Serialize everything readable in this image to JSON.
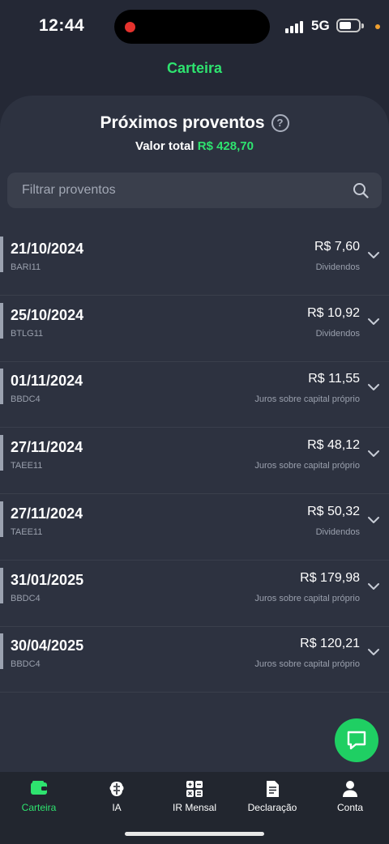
{
  "status_bar": {
    "time": "12:44",
    "network": "5G"
  },
  "header": {
    "title": "Carteira"
  },
  "panel": {
    "title": "Próximos proventos",
    "total_label": "Valor total",
    "total_value": "R$ 428,70"
  },
  "search": {
    "placeholder": "Filtrar proventos"
  },
  "items": [
    {
      "date": "21/10/2024",
      "ticker": "BARI11",
      "amount": "R$ 7,60",
      "type": "Dividendos"
    },
    {
      "date": "25/10/2024",
      "ticker": "BTLG11",
      "amount": "R$ 10,92",
      "type": "Dividendos"
    },
    {
      "date": "01/11/2024",
      "ticker": "BBDC4",
      "amount": "R$ 11,55",
      "type": "Juros sobre capital próprio"
    },
    {
      "date": "27/11/2024",
      "ticker": "TAEE11",
      "amount": "R$ 48,12",
      "type": "Juros sobre capital próprio"
    },
    {
      "date": "27/11/2024",
      "ticker": "TAEE11",
      "amount": "R$ 50,32",
      "type": "Dividendos"
    },
    {
      "date": "31/01/2025",
      "ticker": "BBDC4",
      "amount": "R$ 179,98",
      "type": "Juros sobre capital próprio"
    },
    {
      "date": "30/04/2025",
      "ticker": "BBDC4",
      "amount": "R$ 120,21",
      "type": "Juros sobre capital próprio"
    }
  ],
  "bottom_nav": [
    {
      "label": "Carteira",
      "icon": "wallet-icon",
      "active": true
    },
    {
      "label": "IA",
      "icon": "brain-icon",
      "active": false
    },
    {
      "label": "IR Mensal",
      "icon": "calculator-icon",
      "active": false
    },
    {
      "label": "Declaração",
      "icon": "document-icon",
      "active": false
    },
    {
      "label": "Conta",
      "icon": "user-icon",
      "active": false
    }
  ],
  "colors": {
    "accent": "#2ee36f",
    "background": "#242835",
    "panel": "#2d3240"
  }
}
